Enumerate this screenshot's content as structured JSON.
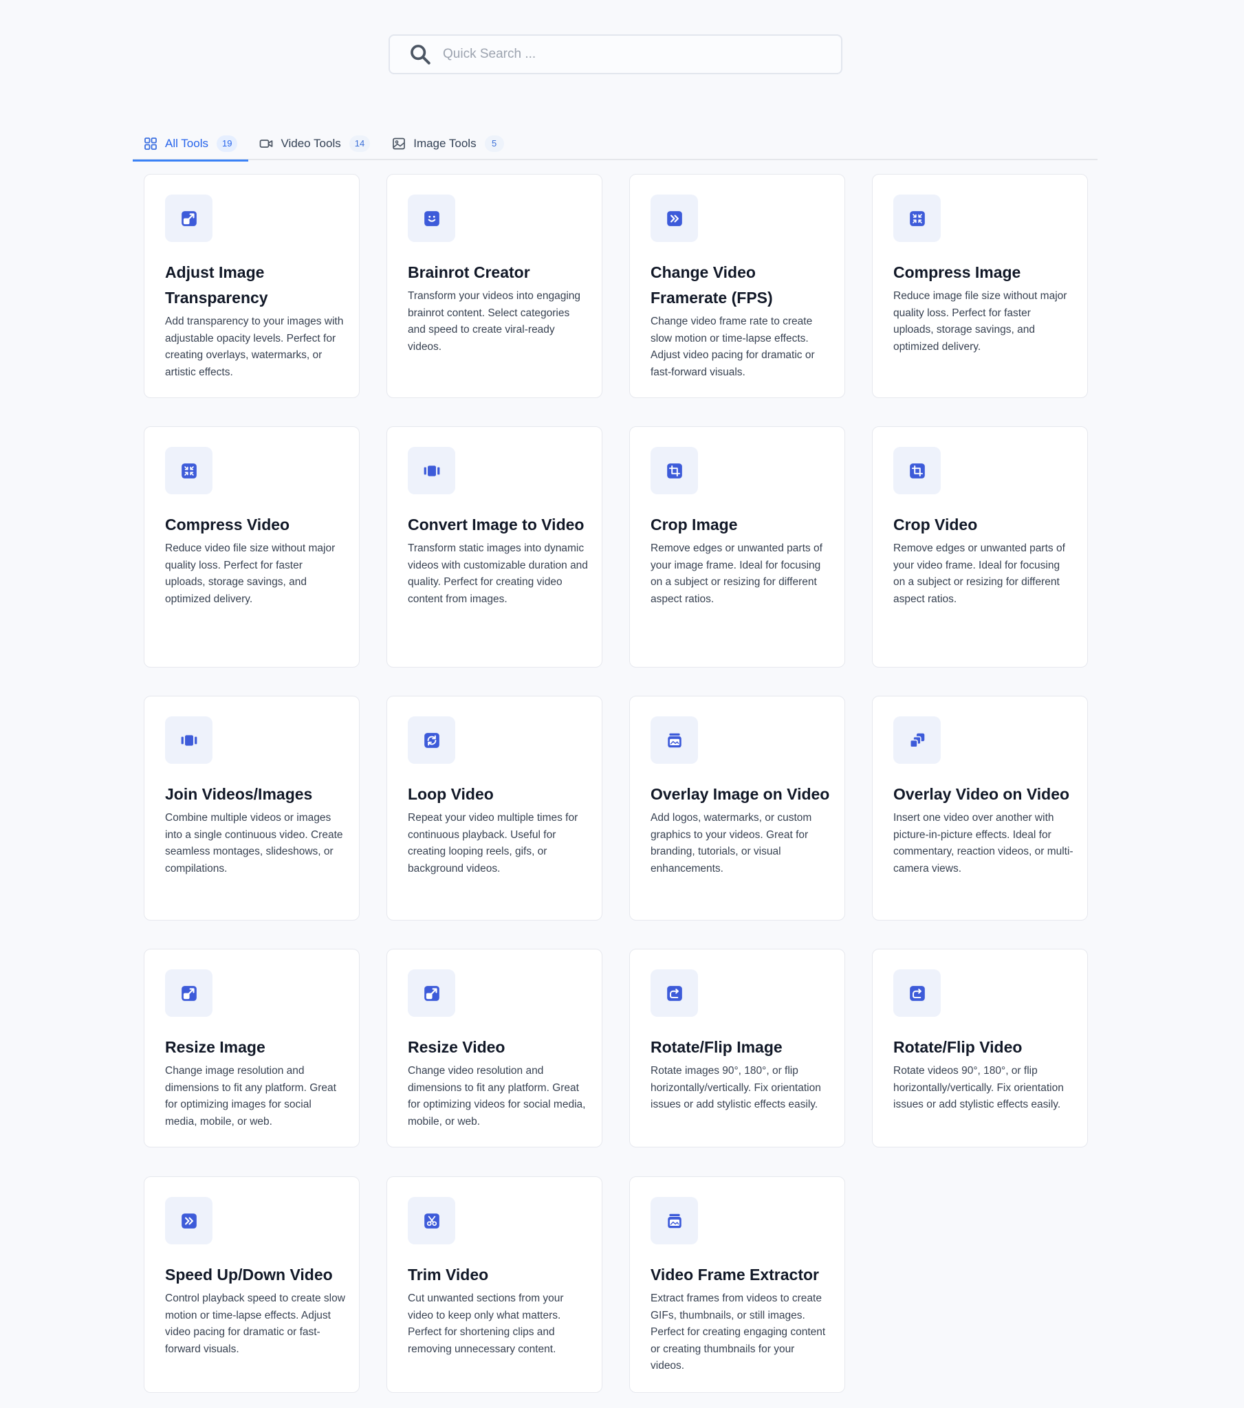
{
  "search": {
    "placeholder": "Quick Search ..."
  },
  "tabs": [
    {
      "label": "All Tools",
      "count": "19",
      "icon": "grid-icon",
      "active": true
    },
    {
      "label": "Video Tools",
      "count": "14",
      "icon": "video-camera-icon",
      "active": false
    },
    {
      "label": "Image Tools",
      "count": "5",
      "icon": "image-icon",
      "active": false
    }
  ],
  "colors": {
    "accent": "#3b5bdb",
    "icon_bg": "#eef2fb",
    "tab_active": "#2563eb"
  },
  "tools": [
    {
      "title": "Adjust Image Transparency",
      "icon": "resize-arrow-icon",
      "description": "Add transparency to your images with adjustable opacity levels. Perfect for creating overlays, watermarks, or artistic effects."
    },
    {
      "title": "Brainrot Creator",
      "icon": "smile-icon",
      "description": "Transform your videos into engaging brainrot content. Select categories and speed to create viral-ready videos."
    },
    {
      "title": "Change Video Framerate (FPS)",
      "icon": "fast-forward-icon",
      "description": "Change video frame rate to create slow motion or time-lapse effects. Adjust video pacing for dramatic or fast-forward visuals."
    },
    {
      "title": "Compress Image",
      "icon": "compress-icon",
      "description": "Reduce image file size without major quality loss. Perfect for faster uploads, storage savings, and optimized delivery."
    },
    {
      "title": "Compress Video",
      "icon": "compress-icon",
      "description": "Reduce video file size without major quality loss. Perfect for faster uploads, storage savings, and optimized delivery."
    },
    {
      "title": "Convert Image to Video",
      "icon": "film-strip-icon",
      "description": "Transform static images into dynamic videos with customizable duration and quality. Perfect for creating video content from images."
    },
    {
      "title": "Crop Image",
      "icon": "crop-icon",
      "description": "Remove edges or unwanted parts of your image frame. Ideal for focusing on a subject or resizing for different aspect ratios."
    },
    {
      "title": "Crop Video",
      "icon": "crop-icon",
      "description": "Remove edges or unwanted parts of your video frame. Ideal for focusing on a subject or resizing for different aspect ratios."
    },
    {
      "title": "Join Videos/Images",
      "icon": "film-strip-icon",
      "description": "Combine multiple videos or images into a single continuous video. Create seamless montages, slideshows, or compilations."
    },
    {
      "title": "Loop Video",
      "icon": "loop-icon",
      "description": "Repeat your video multiple times for continuous playback. Useful for creating looping reels, gifs, or background videos."
    },
    {
      "title": "Overlay Image on Video",
      "icon": "layers-icon",
      "description": "Add logos, watermarks, or custom graphics to your videos. Great for branding, tutorials, or visual enhancements."
    },
    {
      "title": "Overlay Video on Video",
      "icon": "picture-in-picture-icon",
      "description": "Insert one video over another with picture-in-picture effects. Ideal for commentary, reaction videos, or multi-camera views."
    },
    {
      "title": "Resize Image",
      "icon": "resize-arrow-icon",
      "description": "Change image resolution and dimensions to fit any platform. Great for optimizing images for social media, mobile, or web."
    },
    {
      "title": "Resize Video",
      "icon": "resize-arrow-icon",
      "description": "Change video resolution and dimensions to fit any platform. Great for optimizing videos for social media, mobile, or web."
    },
    {
      "title": "Rotate/Flip Image",
      "icon": "rotate-icon",
      "description": "Rotate images 90°, 180°, or flip horizontally/vertically. Fix orientation issues or add stylistic effects easily."
    },
    {
      "title": "Rotate/Flip Video",
      "icon": "rotate-icon",
      "description": "Rotate videos 90°, 180°, or flip horizontally/vertically. Fix orientation issues or add stylistic effects easily."
    },
    {
      "title": "Speed Up/Down Video",
      "icon": "fast-forward-icon",
      "description": "Control playback speed to create slow motion or time-lapse effects. Adjust video pacing for dramatic or fast-forward visuals."
    },
    {
      "title": "Trim Video",
      "icon": "scissors-icon",
      "description": "Cut unwanted sections from your video to keep only what matters. Perfect for shortening clips and removing unnecessary content."
    },
    {
      "title": "Video Frame Extractor",
      "icon": "layers-icon",
      "description": "Extract frames from videos to create GIFs, thumbnails, or still images. Perfect for creating engaging content or creating thumbnails for your videos."
    }
  ]
}
